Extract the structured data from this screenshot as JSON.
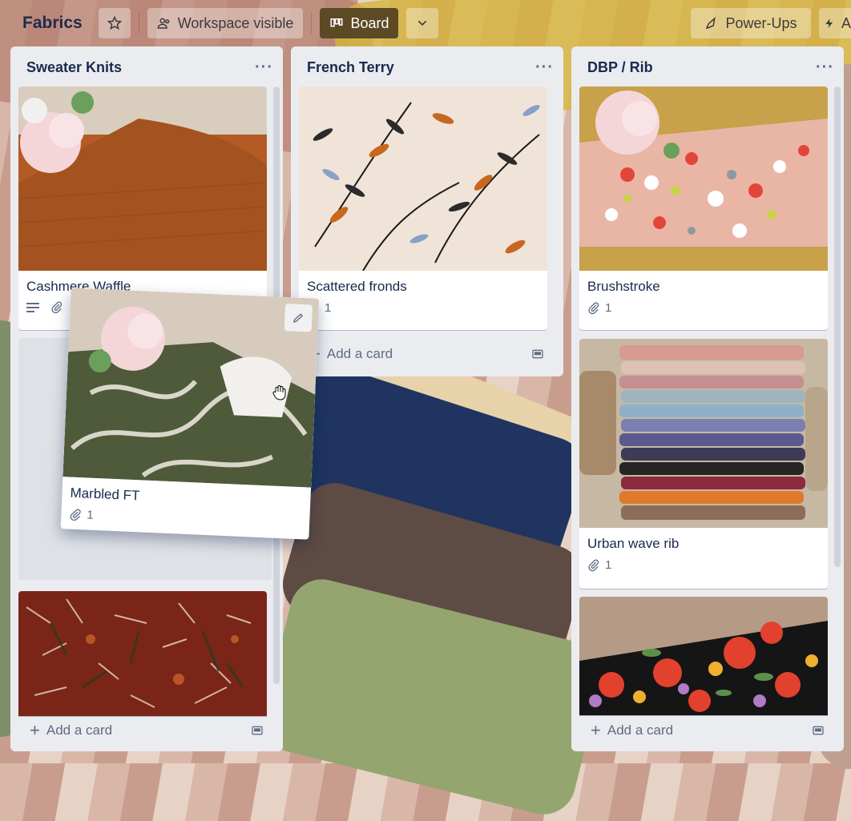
{
  "board": {
    "title": "Fabrics",
    "visibility_label": "Workspace visible",
    "view_label": "Board",
    "powerups_label": "Power-Ups",
    "automation_label": "A"
  },
  "lists": [
    {
      "title": "Sweater Knits",
      "cards": [
        {
          "title": "Cashmere Waffle",
          "has_description": true,
          "attachments": ""
        },
        {
          "title": "",
          "attachments": ""
        }
      ],
      "add_card_label": "Add a card"
    },
    {
      "title": "French Terry",
      "cards": [
        {
          "title": "Scattered fronds",
          "attachments": "1"
        }
      ],
      "add_card_label": "Add a card"
    },
    {
      "title": "DBP / Rib",
      "cards": [
        {
          "title": "Brushstroke",
          "attachments": "1"
        },
        {
          "title": "Urban wave rib",
          "attachments": "1"
        },
        {
          "title": "",
          "attachments": ""
        }
      ],
      "add_card_label": "Add a card"
    }
  ],
  "dragged_card": {
    "title": "Marbled FT",
    "attachments": "1"
  },
  "colors": {
    "list_bg": "#ebecf0",
    "view_button_bg": "#5b4a24",
    "title_text": "#172b4d"
  }
}
